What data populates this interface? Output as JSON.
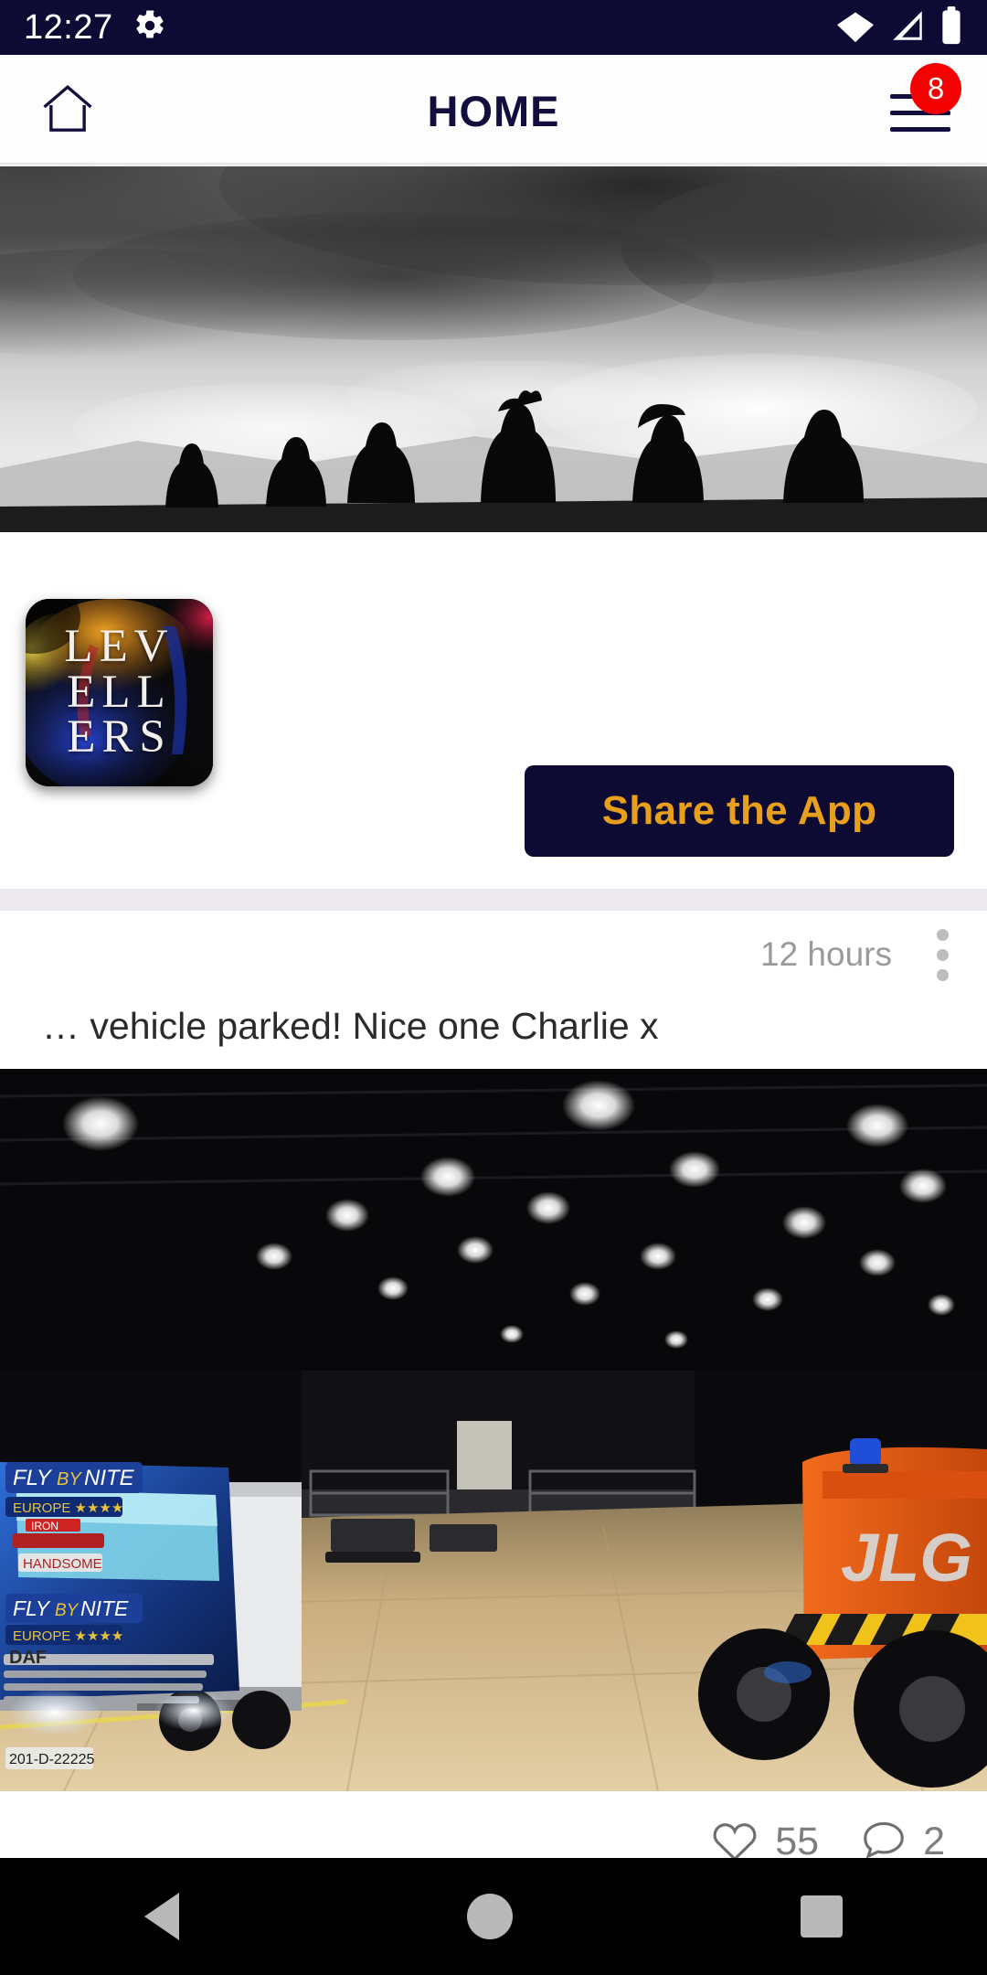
{
  "status_bar": {
    "time": "12:27",
    "icons": [
      "gear-icon",
      "wifi-icon",
      "cellular-signal-icon",
      "battery-icon"
    ],
    "background_color": "#0d0b33"
  },
  "app_bar": {
    "home_icon": "home-icon",
    "title": "HOME",
    "menu_icon": "hamburger-menu-icon",
    "notification_badge": "8",
    "badge_color": "#f40000",
    "title_color": "#120f3f",
    "background_color": "#fdfdfd"
  },
  "hero": {
    "alt": "black and white photo of silhouetted band members standing on a hilltop against dramatic storm clouds"
  },
  "logo": {
    "line1": "LEV",
    "line2": "ELL",
    "line3": "ERS",
    "alt": "Levellers album artwork logo badge"
  },
  "share": {
    "label": "Share the App",
    "background_color": "#0d0b33",
    "text_color": "#e8a01c"
  },
  "post": {
    "time": "12 hours",
    "overflow_icon": "more-vertical-icon",
    "text": "… vehicle parked! Nice one Charlie x",
    "image_alt": "blue DAF Fly By Nite Europe truck with white trailer parked inside a large empty arena next to an orange JLG cherry picker",
    "like_icon": "heart-icon",
    "like_count": "55",
    "comment_icon": "comment-icon",
    "comment_count": "2"
  },
  "navigation_bar": {
    "back": "back-triangle-icon",
    "home": "home-circle-icon",
    "recents": "recents-square-icon",
    "background_color": "#000000"
  }
}
